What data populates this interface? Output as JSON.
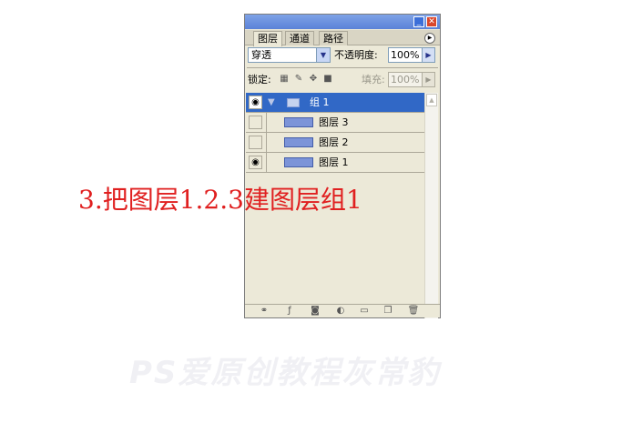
{
  "tabs": [
    {
      "label": "图层",
      "active": true
    },
    {
      "label": "通道",
      "active": false
    },
    {
      "label": "路径",
      "active": false
    }
  ],
  "blend_mode": "穿透",
  "opacity_label": "不透明度:",
  "opacity_value": "100%",
  "lock_label": "锁定:",
  "fill_label": "填充:",
  "fill_value": "100%",
  "layers": [
    {
      "name": "组 1",
      "type": "group",
      "visible": true,
      "selected": true
    },
    {
      "name": "图层 3",
      "type": "layer",
      "visible": false,
      "selected": false
    },
    {
      "name": "图层 2",
      "type": "layer",
      "visible": false,
      "selected": false
    },
    {
      "name": "图层 1",
      "type": "layer",
      "visible": true,
      "selected": false
    }
  ],
  "caption": "3.把图层1.2.3建图层组1",
  "watermark": "PS爱原创教程灰常豹",
  "colors": {
    "selection": "#3168c6",
    "caption": "#e02020",
    "panel_bg": "#ece9d8"
  },
  "icons": {
    "eye": "eye-icon",
    "group_folder": "folder-icon",
    "expand_arrow": "triangle-down-icon"
  }
}
